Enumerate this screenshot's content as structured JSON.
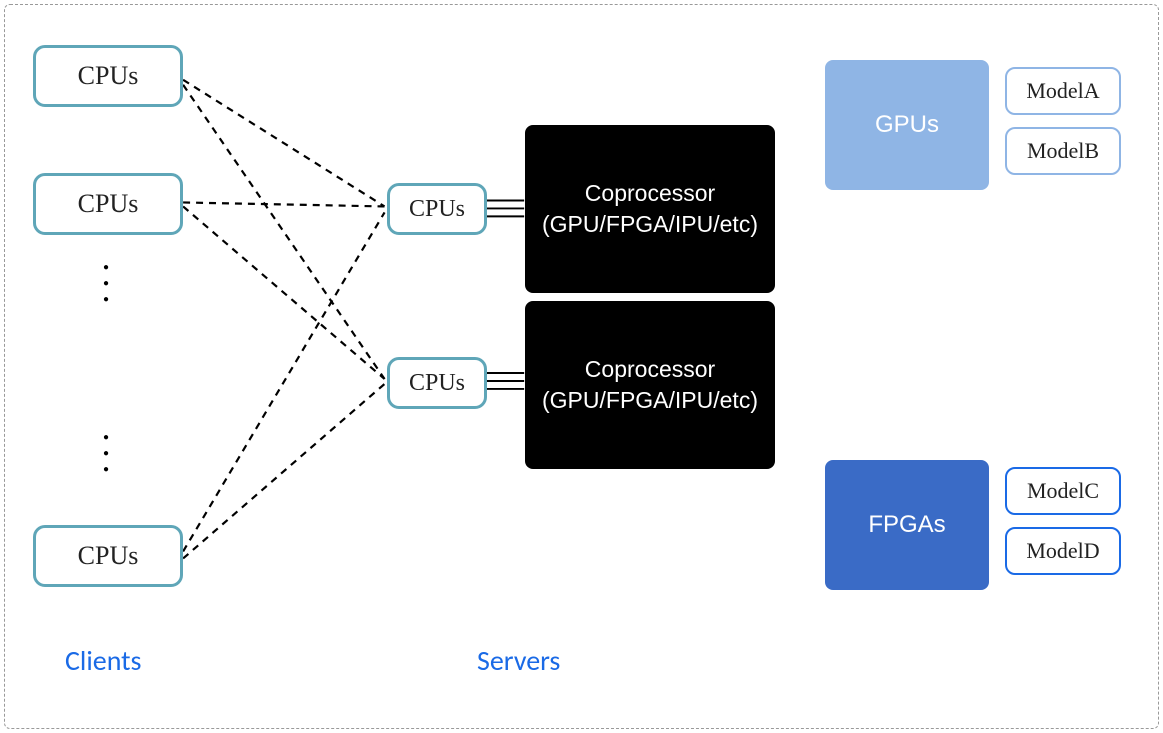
{
  "clients": {
    "label": "Clients",
    "boxes": [
      "CPUs",
      "CPUs",
      "CPUs"
    ]
  },
  "servers": {
    "label": "Servers",
    "cpuBoxes": [
      "CPUs",
      "CPUs"
    ],
    "coprocs": [
      "Coprocessor (GPU/FPGA/IPU/etc)",
      "Coprocessor (GPU/FPGA/IPU/etc)"
    ]
  },
  "accelerators": {
    "gpus": {
      "label": "GPUs",
      "models": [
        "ModelA",
        "ModelB"
      ]
    },
    "fpgas": {
      "label": "FPGAs",
      "models": [
        "ModelC",
        "ModelD"
      ]
    }
  }
}
